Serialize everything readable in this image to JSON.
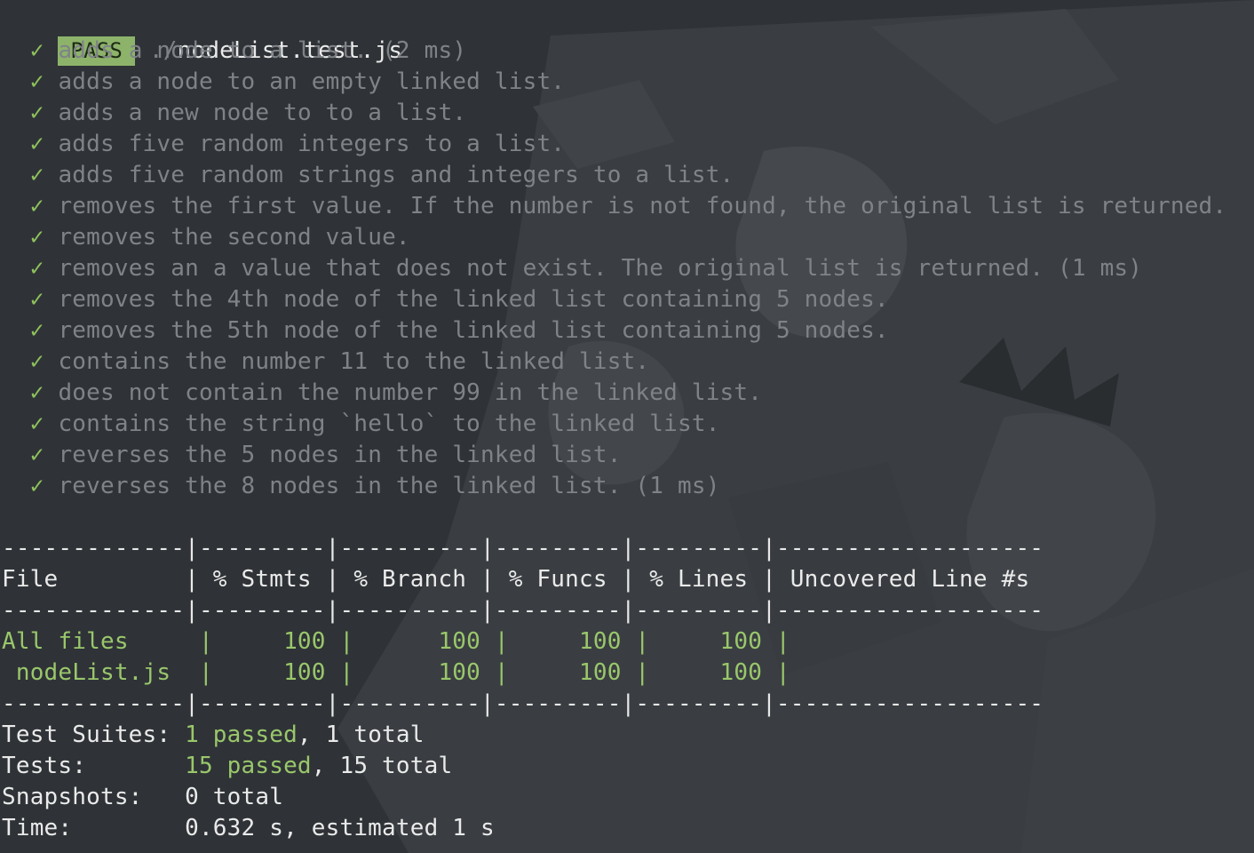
{
  "header": {
    "badge": "PASS",
    "path_prefix": "./",
    "filename": "nodeList.test.js"
  },
  "check_icon": "✓",
  "tests": [
    "adds a node to a list. (2 ms)",
    "adds a node to an empty linked list.",
    "adds a new node to to a list.",
    "adds five random integers to a list.",
    "adds five random strings and integers to a list.",
    "removes the first value. If the number is not found, the original list is returned.",
    "removes the second value.",
    "removes an a value that does not exist. The original list is returned. (1 ms)",
    "removes the 4th node of the linked list containing 5 nodes.",
    "removes the 5th node of the linked list containing 5 nodes.",
    "contains the number 11 to the linked list.",
    "does not contain the number 99 in the linked list.",
    "contains the string `hello` to the linked list.",
    "reverses the 5 nodes in the linked list.",
    "reverses the 8 nodes in the linked list. (1 ms)"
  ],
  "coverage": {
    "separator": "-------------|---------|----------|---------|---------|-------------------",
    "header_row": "File         | % Stmts | % Branch | % Funcs | % Lines | Uncovered Line #s ",
    "rows": [
      {
        "file": "All files    ",
        "rest": " |     100 |      100 |     100 |     100 |                   "
      },
      {
        "file": " nodeList.js ",
        "rest": " |     100 |      100 |     100 |     100 |                   "
      }
    ]
  },
  "summary": {
    "suites_label": "Test Suites: ",
    "suites_passed": "1 passed",
    "suites_total": ", 1 total",
    "tests_label": "Tests:       ",
    "tests_passed": "15 passed",
    "tests_total": ", 15 total",
    "snapshots_label": "Snapshots:   ",
    "snapshots_value": "0 total",
    "time_label": "Time:        ",
    "time_value": "0.632 s, estimated 1 s"
  },
  "colors": {
    "badge_bg": "#8db36a",
    "check": "#8fc25c",
    "pass_green": "#9ac76b",
    "terminal_bg": "#2f3337"
  }
}
